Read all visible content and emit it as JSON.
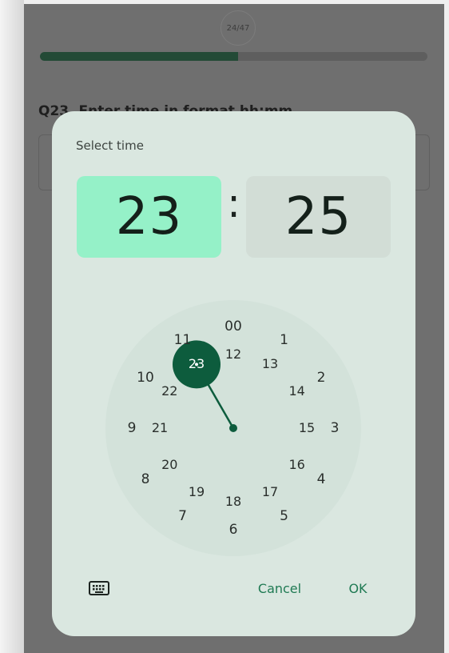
{
  "background": {
    "progress": {
      "label": "24/47",
      "fraction": 0.5106
    },
    "question": "Q23. Enter time in format hh:mm"
  },
  "dialog": {
    "title": "Select time",
    "hour": "23",
    "separator": ":",
    "minute": "25",
    "selected_hour_label": "23",
    "outer_hours": [
      "00",
      "1",
      "2",
      "3",
      "4",
      "5",
      "6",
      "7",
      "8",
      "9",
      "10",
      "11"
    ],
    "inner_hours": [
      "12",
      "13",
      "14",
      "15",
      "16",
      "17",
      "18",
      "19",
      "20",
      "21",
      "22",
      "23"
    ],
    "keyboard_icon": "keyboard-icon",
    "cancel_label": "Cancel",
    "ok_label": "OK"
  },
  "colors": {
    "accent": "#1f7a53",
    "hand": "#0d5c3d",
    "hour_highlight": "#95f1c8",
    "dialog_bg": "#dae7e0",
    "scrim": "#6f6f6f"
  }
}
